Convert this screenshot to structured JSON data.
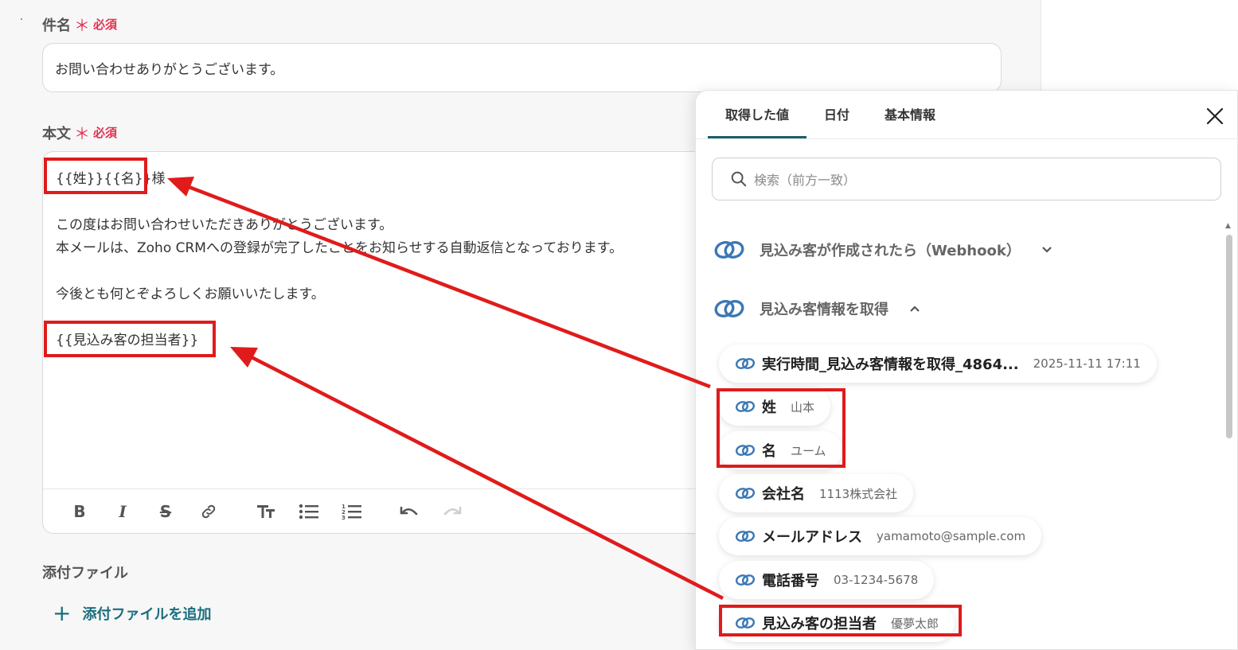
{
  "form": {
    "subject": {
      "label": "件名",
      "required_mark": "＊",
      "required_text": "必須",
      "value": "お問い合わせありがとうございます。"
    },
    "body": {
      "label": "本文",
      "required_mark": "＊",
      "required_text": "必須",
      "lines": [
        "{{姓}}{{名}}様",
        "",
        "この度はお問い合わせいただきありがとうございます。",
        "本メールは、Zoho CRMへの登録が完了したことをお知らせする自動返信となっております。",
        "",
        "今後とも何とぞよろしくお願いいたします。",
        "",
        "{{見込み客の担当者}}"
      ]
    },
    "toolbar": {
      "icons": [
        "bold-icon",
        "italic-icon",
        "strikethrough-icon",
        "link-icon",
        "text-size-icon",
        "bullet-list-icon",
        "numbered-list-icon",
        "undo-icon",
        "redo-icon"
      ]
    },
    "attachments": {
      "label": "添付ファイル",
      "add_label": "添付ファイルを追加"
    }
  },
  "panel": {
    "tabs": [
      {
        "label": "取得した値",
        "active": true
      },
      {
        "label": "日付",
        "active": false
      },
      {
        "label": "基本情報",
        "active": false
      }
    ],
    "search_placeholder": "検索（前方一致）",
    "sections": [
      {
        "title": "見込み客が作成されたら（Webhook）",
        "expanded": false
      },
      {
        "title": "見込み客情報を取得",
        "expanded": true
      }
    ],
    "items": [
      {
        "name": "実行時間_見込み客情報を取得_4864...",
        "value": "2025-11-11 17:11"
      },
      {
        "name": "姓",
        "value": "山本"
      },
      {
        "name": "名",
        "value": "ユーム"
      },
      {
        "name": "会社名",
        "value": "1113株式会社"
      },
      {
        "name": "メールアドレス",
        "value": "yamamoto@sample.com"
      },
      {
        "name": "電話番号",
        "value": "03-1234-5678"
      },
      {
        "name": "見込み客の担当者",
        "value": "優夢太郎"
      }
    ]
  },
  "colors": {
    "accent": "#1a5f6f",
    "required": "#e0334f",
    "annotation": "#e01b1b",
    "link_icon": "#3b78b5"
  }
}
